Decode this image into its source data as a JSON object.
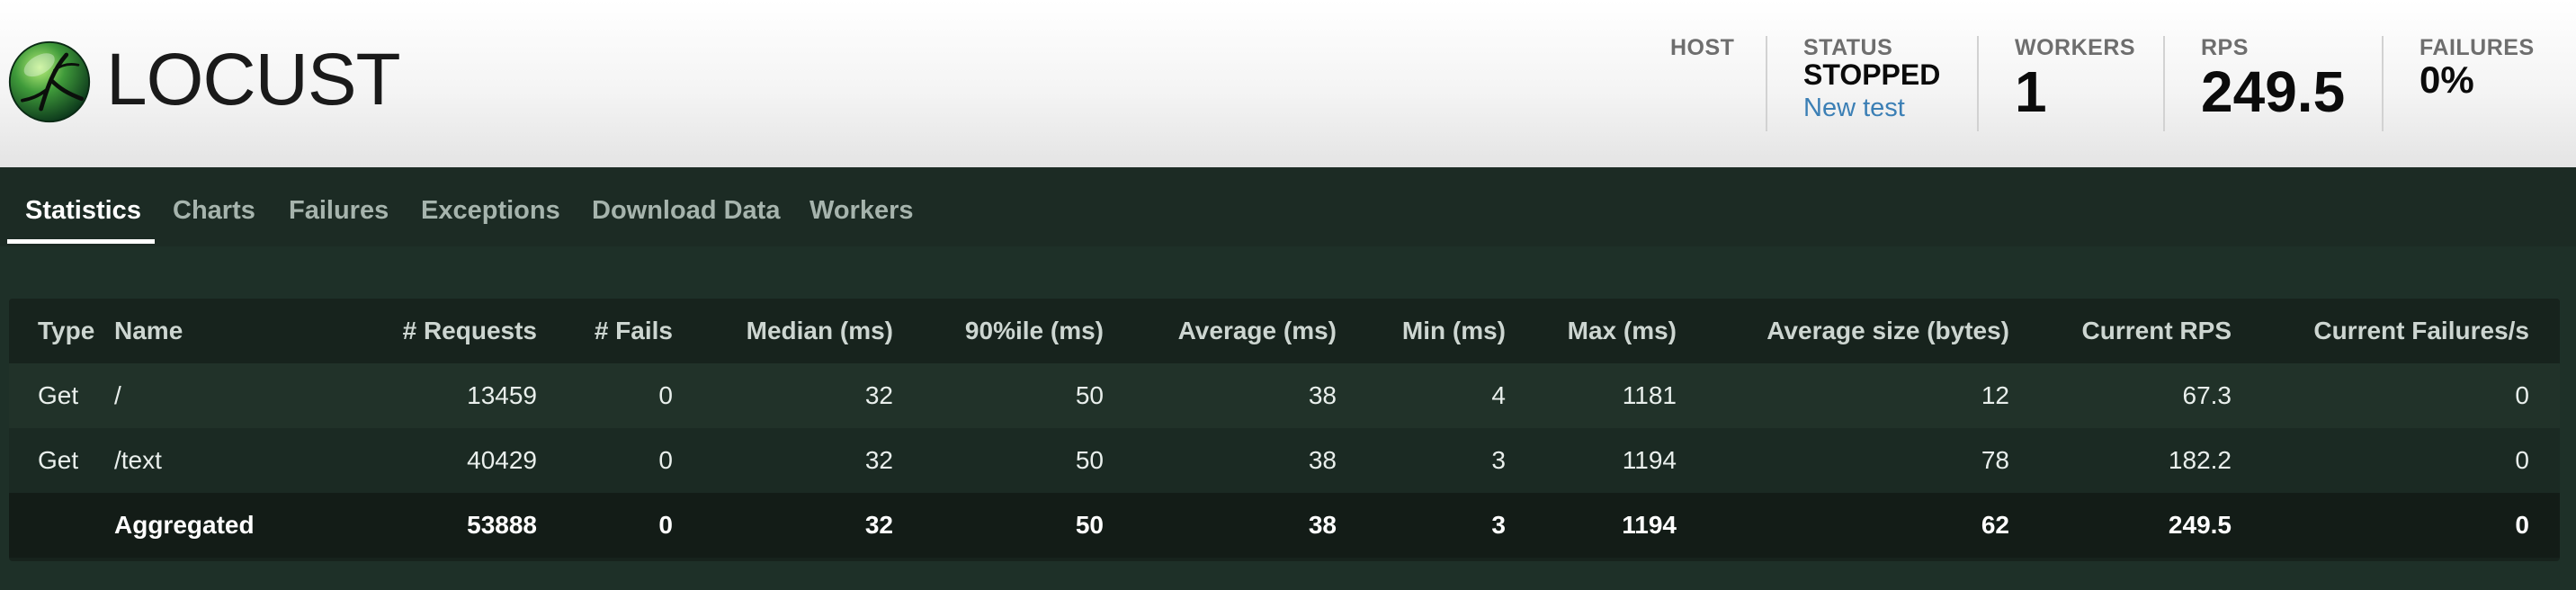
{
  "app": {
    "name": "LOCUST"
  },
  "header_stats": {
    "host": {
      "label": "HOST",
      "value": ""
    },
    "status": {
      "label": "STATUS",
      "value": "STOPPED",
      "link": "New test"
    },
    "workers": {
      "label": "WORKERS",
      "value": "1"
    },
    "rps": {
      "label": "RPS",
      "value": "249.5"
    },
    "failures": {
      "label": "FAILURES",
      "value": "0%"
    }
  },
  "tabs": [
    {
      "label": "Statistics",
      "active": true
    },
    {
      "label": "Charts"
    },
    {
      "label": "Failures"
    },
    {
      "label": "Exceptions"
    },
    {
      "label": "Download Data"
    },
    {
      "label": "Workers"
    }
  ],
  "table": {
    "columns": [
      "Type",
      "Name",
      "# Requests",
      "# Fails",
      "Median (ms)",
      "90%ile (ms)",
      "Average (ms)",
      "Min (ms)",
      "Max (ms)",
      "Average size (bytes)",
      "Current RPS",
      "Current Failures/s"
    ],
    "rows": [
      [
        "Get",
        "/",
        "13459",
        "0",
        "32",
        "50",
        "38",
        "4",
        "1181",
        "12",
        "67.3",
        "0"
      ],
      [
        "Get",
        "/text",
        "40429",
        "0",
        "32",
        "50",
        "38",
        "3",
        "1194",
        "78",
        "182.2",
        "0"
      ]
    ],
    "aggregated": [
      "",
      "Aggregated",
      "53888",
      "0",
      "32",
      "50",
      "38",
      "3",
      "1194",
      "62",
      "249.5",
      "0"
    ]
  },
  "colors": {
    "nav_bg": "#1c2b24",
    "content_bg": "#1e3028",
    "link": "#3b7fb5"
  },
  "icons": {
    "logo": "locust-logo-icon"
  }
}
